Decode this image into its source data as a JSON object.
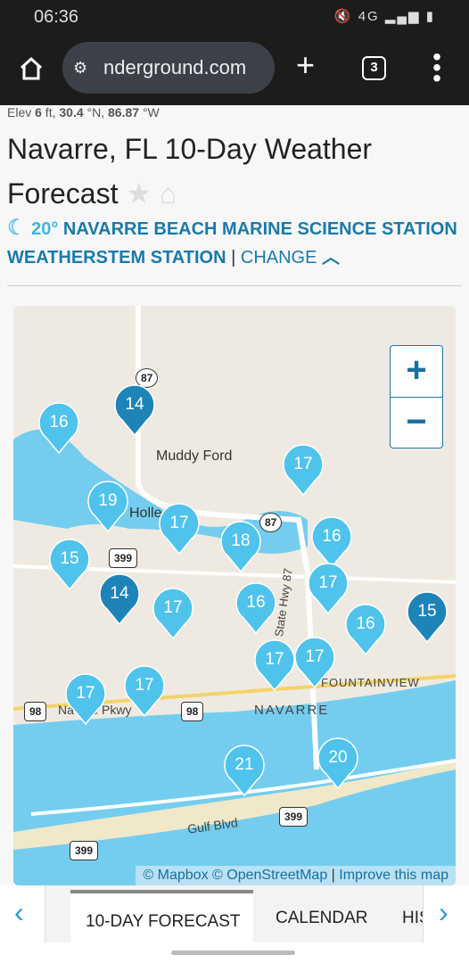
{
  "status": {
    "time": "06:36",
    "icons": "🔇 4G ▂▄▆ ▮"
  },
  "browser": {
    "url": "nderground.com",
    "tab_count": "3"
  },
  "location": {
    "elev_label": "Elev ",
    "elev": "6",
    "elev_unit": " ft, ",
    "lat": "30.4",
    "lat_unit": " °N, ",
    "lon": "86.87",
    "lon_unit": " °W"
  },
  "title": "Navarre, FL 10-Day Weather Forecast",
  "station": {
    "temp": "20°",
    "name": "NAVARRE BEACH MARINE SCIENCE STATION WEATHERSTEM STATION",
    "separator": "|",
    "change": "CHANGE"
  },
  "map": {
    "labels": {
      "muddy_ford": "Muddy Ford",
      "holley": "Holle",
      "navarre": "NAVARRE",
      "fountainview": "FOUNTAINVIEW",
      "pkwy": "Na     e Pkwy",
      "state_hwy": "State Hwy 87",
      "gulf_blvd": "Gulf Blvd"
    },
    "road_shields": [
      "87",
      "87",
      "399",
      "98",
      "98",
      "399",
      "399"
    ],
    "zoom_in": "+",
    "zoom_out": "−",
    "attribution": {
      "mapbox": "© Mapbox",
      "osm": "© OpenStreetMap",
      "sep": "|",
      "improve": "Improve this map"
    },
    "markers": [
      16,
      14,
      19,
      17,
      18,
      17,
      16,
      17,
      15,
      14,
      17,
      16,
      16,
      15,
      17,
      17,
      17,
      17,
      21,
      20
    ],
    "colors": {
      "marker": "#4fc3ec",
      "marker_dark": "#1e84b8",
      "water": "#74cdef",
      "land": "#efeae1"
    }
  },
  "bottom_tabs": [
    "10-DAY FORECAST",
    "CALENDAR",
    "HISTORY"
  ]
}
